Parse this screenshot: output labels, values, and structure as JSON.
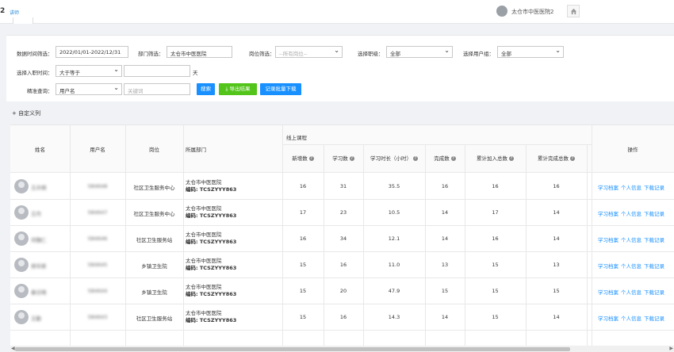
{
  "topbar": {
    "version": "2",
    "badge": "讲师",
    "hospital_user": "太仓市中医医院2"
  },
  "filters": {
    "date_label": "数据时间筛选：",
    "date_value": "2022/01/01-2022/12/31",
    "dept_label": "部门筛选：",
    "dept_value": "太仓市中医医院",
    "post_label": "岗位筛选：",
    "post_value": "--所有岗位--",
    "rank_label": "选择职级：",
    "rank_value": "全部",
    "group_label": "选择用户组：",
    "group_value": "全部",
    "join_label": "选择入职时间：",
    "join_op": "大于等于",
    "join_unit": "天",
    "query_label": "精准查询：",
    "query_field": "用户名",
    "keyword_placeholder": "关键词",
    "search_btn": "搜索",
    "export_btn": "导出结果",
    "download_btn": "记录批量下载"
  },
  "custom_columns": "+ 自定义列",
  "table": {
    "headers": {
      "name": "姓名",
      "username": "用户名",
      "post": "岗位",
      "dept": "所属部门",
      "online_group": "线上课程",
      "new_count": "新增数",
      "learn_count": "学习数",
      "learn_hours": "学习时长（小时）",
      "done_count": "完成数",
      "total_join": "累计加入总数",
      "total_done": "累计完成总数",
      "ops": "操作"
    },
    "rows": [
      {
        "name": "王卉棋",
        "username": "584648",
        "post": "社区卫生服务中心",
        "dept": "太仓市中医医院",
        "code": "编码: TCSZYYY863",
        "new": "16",
        "learn": "31",
        "hours": "35.5",
        "done": "16",
        "tjoin": "16",
        "tdone": "16"
      },
      {
        "name": "王丹",
        "username": "584647",
        "post": "社区卫生服务中心",
        "dept": "太仓市中医医院",
        "code": "编码: TCSZYYY863",
        "new": "17",
        "learn": "23",
        "hours": "10.5",
        "done": "14",
        "tjoin": "17",
        "tdone": "14"
      },
      {
        "name": "邓魏仁",
        "username": "584646",
        "post": "社区卫生服务站",
        "dept": "太仓市中医医院",
        "code": "编码: TCSZYYY863",
        "new": "16",
        "learn": "34",
        "hours": "12.1",
        "done": "14",
        "tjoin": "16",
        "tdone": "14"
      },
      {
        "name": "郑华新",
        "username": "584645",
        "post": "乡镇卫生院",
        "dept": "太仓市中医医院",
        "code": "编码: TCSZYYY863",
        "new": "15",
        "learn": "16",
        "hours": "11.0",
        "done": "13",
        "tjoin": "15",
        "tdone": "13"
      },
      {
        "name": "秦日晓",
        "username": "584644",
        "post": "乡镇卫生院",
        "dept": "太仓市中医医院",
        "code": "编码: TCSZYYY863",
        "new": "15",
        "learn": "20",
        "hours": "47.9",
        "done": "15",
        "tjoin": "15",
        "tdone": "15"
      },
      {
        "name": "王勤",
        "username": "584643",
        "post": "社区卫生服务站",
        "dept": "太仓市中医医院",
        "code": "编码: TCSZYYY863",
        "new": "15",
        "learn": "16",
        "hours": "14.3",
        "done": "14",
        "tjoin": "15",
        "tdone": "14"
      }
    ],
    "ops_links": [
      "学习档案",
      "个人信息",
      "下载记录"
    ]
  }
}
